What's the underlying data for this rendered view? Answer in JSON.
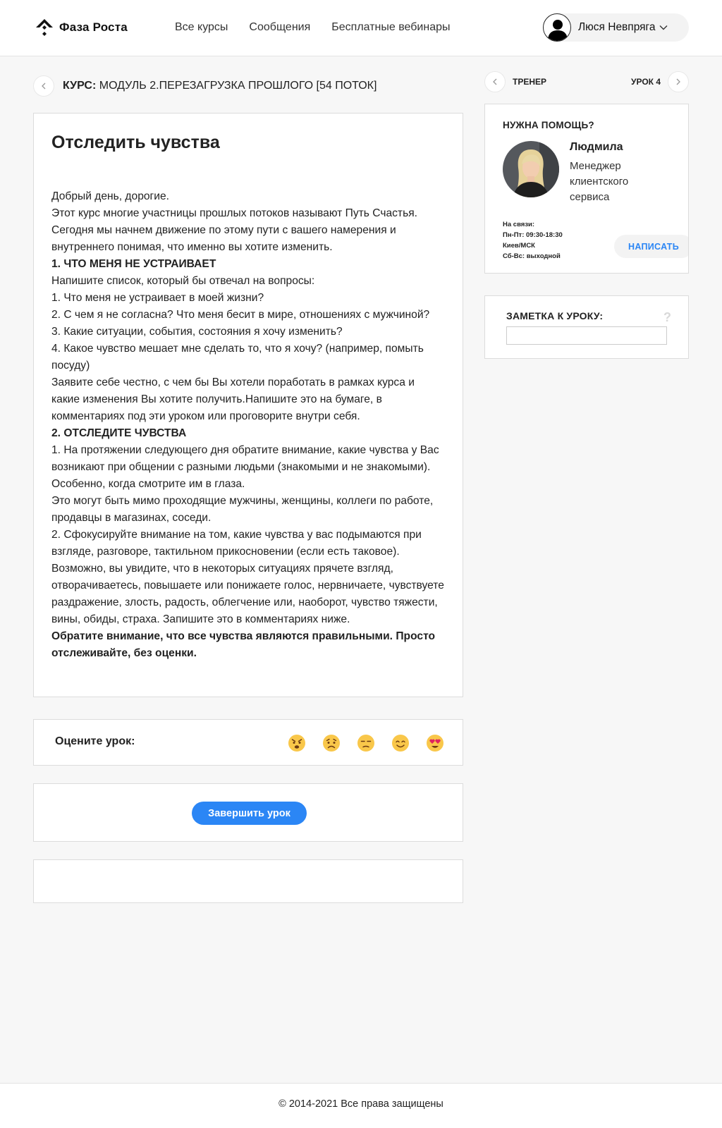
{
  "header": {
    "logo_text": "Фаза Роста",
    "nav": [
      "Все курсы",
      "Сообщения",
      "Бесплатные вебинары"
    ],
    "user_name": "Люся Невпряга"
  },
  "breadcrumb": {
    "label": "КУРС:",
    "course": "МОДУЛЬ 2.ПЕРЕЗАГРУЗКА ПРОШЛОГО [54 ПОТОК]"
  },
  "lesson": {
    "title": "Отследить чувства",
    "paragraphs": [
      {
        "text": "Добрый день, дорогие.",
        "bold": false
      },
      {
        "text": "Этот курс многие участницы прошлых потоков называют Путь Счастья. Сегодня мы начнем движение по этому пути с вашего намерения и внутреннего понимая, что именно вы хотите изменить.",
        "bold": false
      },
      {
        "text": "1. ЧТО МЕНЯ НЕ УСТРАИВАЕТ",
        "bold": true
      },
      {
        "text": "Напишите список, который бы отвечал на вопросы:",
        "bold": false
      },
      {
        "text": "1. Что меня не устраивает в моей жизни?",
        "bold": false
      },
      {
        "text": "2. С чем я не согласна? Что меня бесит в мире, отношениях с мужчиной?",
        "bold": false
      },
      {
        "text": "3. Какие ситуации, события, состояния я хочу изменить?",
        "bold": false
      },
      {
        "text": "4. Какое чувство мешает мне сделать то, что я хочу? (например, помыть посуду)",
        "bold": false
      },
      {
        "text": "Заявите себе честно, с чем бы Вы хотели поработать в рамках курса и какие изменения Вы хотите получить.Напишите это на бумаге, в комментариях под эти уроком или проговорите внутри себя.",
        "bold": false
      },
      {
        "text": "2. ОТСЛЕДИТЕ ЧУВСТВА",
        "bold": true
      },
      {
        "text": "1. На протяжении следующего дня обратите внимание, какие чувства у Вас возникают при общении с разными людьми (знакомыми и не знакомыми). Особенно, когда смотрите им в глаза.",
        "bold": false
      },
      {
        "text": "Это могут быть мимо проходящие мужчины, женщины, коллеги по работе, продавцы в магазинах, соседи.",
        "bold": false
      },
      {
        "text": "2. Сфокусируйте внимание на том, какие чувства у вас подымаются при взгляде, разговоре, тактильном прикосновении (если есть таковое). Возможно, вы увидите, что в некоторых ситуациях прячете взгляд, отворачиваетесь, повышаете или понижаете голос, нервничаете, чувствуете раздражение, злость, радость, облегчение или, наоборот, чувство тяжести, вины, обиды, страха. Запишите это в комментариях ниже.",
        "bold": false
      },
      {
        "text": "Обратите внимание, что все чувства являются правильными. Просто отслеживайте, без оценки.",
        "bold": true
      }
    ]
  },
  "rating": {
    "label": "Оцените урок:",
    "emojis": [
      "angry-face",
      "sad-face",
      "meh-face",
      "smiling-face",
      "heart-eyes-face"
    ]
  },
  "finish": {
    "button_label": "Завершить урок"
  },
  "lesson_nav": {
    "prev_label": "ТРЕНЕР",
    "next_label": "УРОК 4"
  },
  "help": {
    "title": "НУЖНА ПОМОЩЬ?",
    "manager_name": "Людмила",
    "manager_role": "Менеджер клиентского сервиса",
    "hours": [
      "На связи:",
      "Пн-Пт: 09:30-18:30",
      "Киев/МСК",
      "Сб-Вс: выходной"
    ],
    "write_label": "НАПИСАТЬ"
  },
  "note": {
    "title": "ЗАМЕТКА К УРОКУ:",
    "help_glyph": "?"
  },
  "footer": {
    "copyright": "© 2014-2021 Все права защищены"
  },
  "colors": {
    "accent": "#2b86f5",
    "background": "#f7f7f7",
    "emoji": "#f9c74a"
  }
}
